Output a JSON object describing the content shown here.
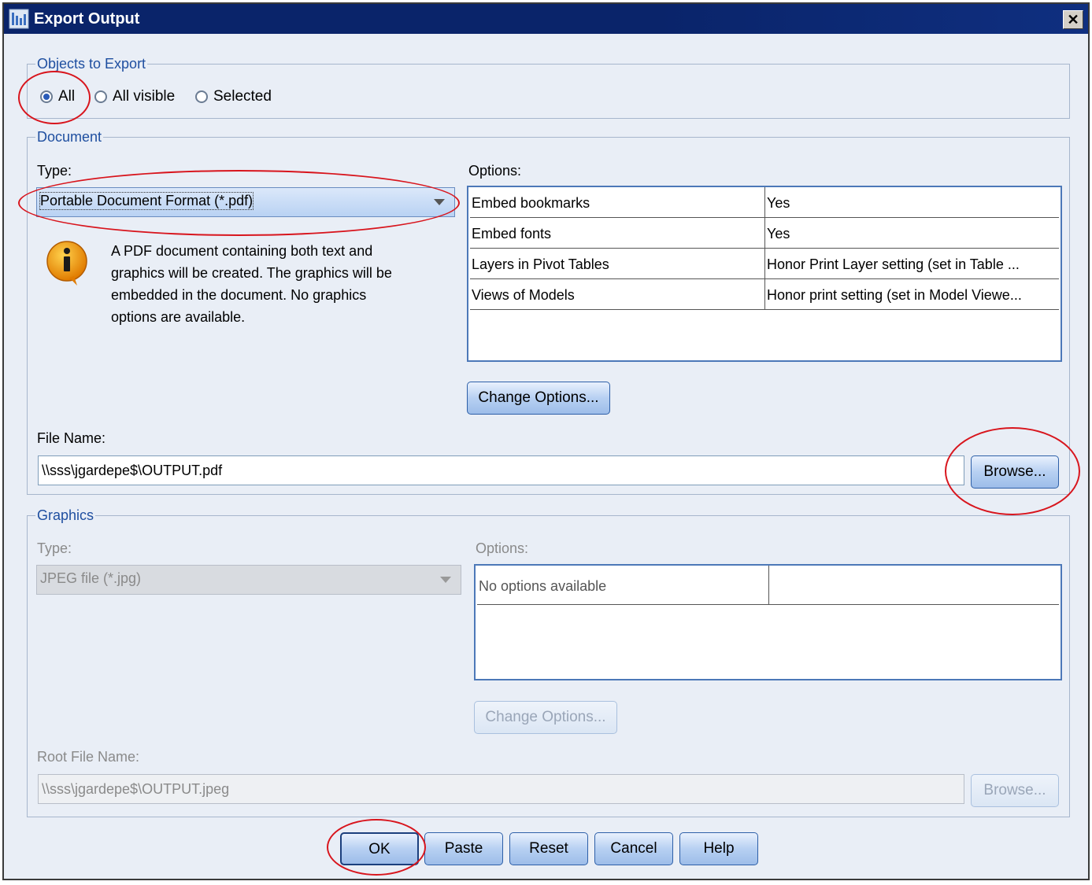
{
  "window": {
    "title": "Export Output",
    "close_label": "✕"
  },
  "objects": {
    "legend": "Objects to Export",
    "options": [
      "All",
      "All visible",
      "Selected"
    ],
    "selected": "All"
  },
  "document": {
    "legend": "Document",
    "type_label": "Type:",
    "type_value": "Portable Document Format (*.pdf)",
    "info_icon": "info-icon",
    "info_lines": [
      "A PDF document containing both text and",
      "graphics will be created. The graphics will be",
      "embedded in the document. No graphics",
      "options are available."
    ],
    "options_label": "Options:",
    "options": [
      {
        "name": "Embed bookmarks",
        "value": "Yes"
      },
      {
        "name": "Embed fonts",
        "value": "Yes"
      },
      {
        "name": "Layers in Pivot Tables",
        "value": "Honor Print Layer setting (set in Table ..."
      },
      {
        "name": "Views of Models",
        "value": "Honor print setting (set in Model Viewe..."
      }
    ],
    "change_options": "Change Options...",
    "file_name_label": "File Name:",
    "file_name_value": "\\\\sss\\jgardepe$\\OUTPUT.pdf",
    "browse": "Browse..."
  },
  "graphics": {
    "legend": "Graphics",
    "type_label": "Type:",
    "type_value": "JPEG file (*.jpg)",
    "options_label": "Options:",
    "options": [
      {
        "name": "No options available",
        "value": ""
      }
    ],
    "change_options": "Change Options...",
    "root_file_name_label": "Root File Name:",
    "root_file_name_value": "\\\\sss\\jgardepe$\\OUTPUT.jpeg",
    "browse": "Browse..."
  },
  "footer": {
    "ok": "OK",
    "paste": "Paste",
    "reset": "Reset",
    "cancel": "Cancel",
    "help": "Help"
  },
  "colors": {
    "title_bar": "#0a246a",
    "group_legend": "#1f4fa0",
    "annotation": "#d8151d",
    "dialog_bg": "#e9eef6"
  }
}
